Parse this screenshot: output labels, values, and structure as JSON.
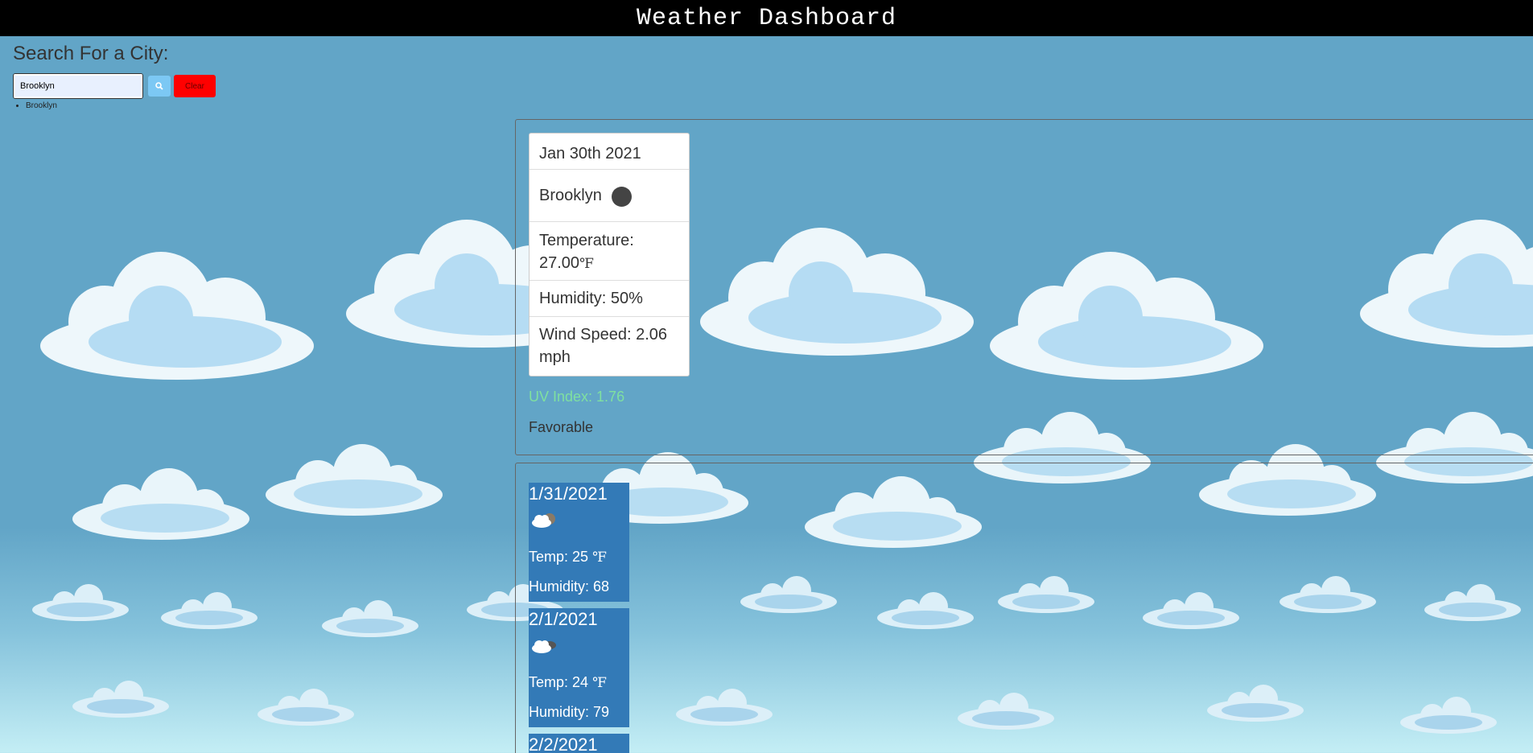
{
  "header": {
    "title": "Weather Dashboard"
  },
  "search": {
    "label": "Search For a City:",
    "input_value": "Brooklyn",
    "search_icon": "search-icon",
    "clear_label": "Clear"
  },
  "history": [
    "Brooklyn"
  ],
  "current": {
    "date": "Jan 30th 2021",
    "city": "Brooklyn",
    "icon": "weather-icon",
    "temperature_label": "Temperature:",
    "temperature_value": "27.00",
    "temperature_unit": "℉",
    "humidity": "Humidity: 50%",
    "wind_label": "Wind Speed: 2.06",
    "wind_unit": "mph",
    "uv": "UV Index: 1.76",
    "uv_status": "Favorable",
    "uv_color": "#7fe0a0"
  },
  "forecast": [
    {
      "date": "1/31/2021",
      "icon": "partly-cloudy-icon",
      "temp": "Temp: 25",
      "unit": "℉",
      "humidity": "Humidity: 68"
    },
    {
      "date": "2/1/2021",
      "icon": "partly-cloudy-icon",
      "temp": "Temp: 24",
      "unit": "℉",
      "humidity": "Humidity: 79"
    },
    {
      "date": "2/2/2021",
      "icon": "partly-cloudy-icon",
      "temp": "",
      "unit": "",
      "humidity": ""
    }
  ],
  "colors": {
    "header_bg": "#000000",
    "sky": "#62a5c7",
    "forecast_card": "#337ab7",
    "clear_button": "#ff0000",
    "search_button": "#7cc8f4"
  }
}
